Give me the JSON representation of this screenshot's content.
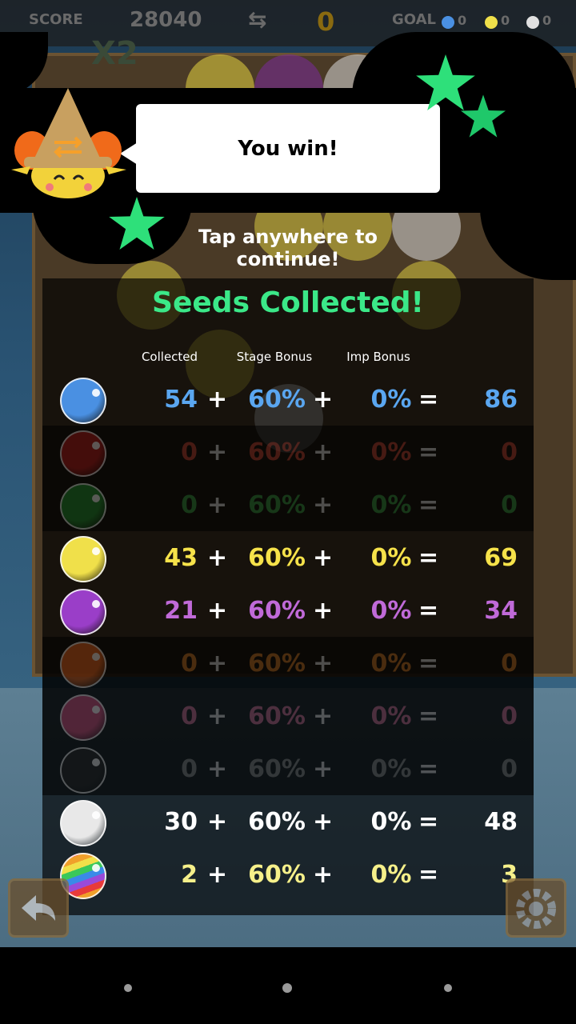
{
  "hud": {
    "score_label": "SCORE",
    "score_value": "28040",
    "moves_value": "0",
    "goal_label": "GOAL",
    "goals": [
      {
        "color": "#4a90e2",
        "count": "0"
      },
      {
        "color": "#f0e04a",
        "count": "0"
      },
      {
        "color": "#e0e0e0",
        "count": "0"
      }
    ],
    "multiplier": "X2"
  },
  "banner": {
    "message": "You win!",
    "continue_hint": "Tap anywhere to continue!"
  },
  "results": {
    "title": "Seeds Collected!",
    "headers": {
      "collected": "Collected",
      "stage_bonus": "Stage Bonus",
      "imp_bonus": "Imp Bonus"
    },
    "operators": {
      "plus": "+",
      "equals": "="
    },
    "rows": [
      {
        "seed": "blue-seed",
        "color": "#5aa6f0",
        "ball": "#4a90e2",
        "collected": "54",
        "stage": "60%",
        "imp": "0%",
        "total": "86",
        "dim": false
      },
      {
        "seed": "red-seed",
        "color": "#e04a3a",
        "ball": "#b01818",
        "collected": "0",
        "stage": "60%",
        "imp": "0%",
        "total": "0",
        "dim": true
      },
      {
        "seed": "green-seed",
        "color": "#3ab04a",
        "ball": "#1d8a2a",
        "collected": "0",
        "stage": "60%",
        "imp": "0%",
        "total": "0",
        "dim": true
      },
      {
        "seed": "yellow-seed",
        "color": "#f6e24a",
        "ball": "#f0e04a",
        "collected": "43",
        "stage": "60%",
        "imp": "0%",
        "total": "69",
        "dim": false
      },
      {
        "seed": "purple-seed",
        "color": "#c06ad8",
        "ball": "#9a3ec8",
        "collected": "21",
        "stage": "60%",
        "imp": "0%",
        "total": "34",
        "dim": false
      },
      {
        "seed": "orange-seed",
        "color": "#f08a2a",
        "ball": "#e0601a",
        "collected": "0",
        "stage": "60%",
        "imp": "0%",
        "total": "0",
        "dim": true
      },
      {
        "seed": "pink-seed",
        "color": "#f07aa8",
        "ball": "#d04a7a",
        "collected": "0",
        "stage": "60%",
        "imp": "0%",
        "total": "0",
        "dim": true
      },
      {
        "seed": "black-seed",
        "color": "#9a9a9a",
        "ball": "#222222",
        "collected": "0",
        "stage": "60%",
        "imp": "0%",
        "total": "0",
        "dim": true
      },
      {
        "seed": "white-seed",
        "color": "#ffffff",
        "ball": "#e8e8e8",
        "collected": "30",
        "stage": "60%",
        "imp": "0%",
        "total": "48",
        "dim": false
      },
      {
        "seed": "rainbow-seed",
        "color": "#f6f08a",
        "ball": "rainbow",
        "collected": "2",
        "stage": "60%",
        "imp": "0%",
        "total": "3",
        "dim": false
      }
    ]
  }
}
